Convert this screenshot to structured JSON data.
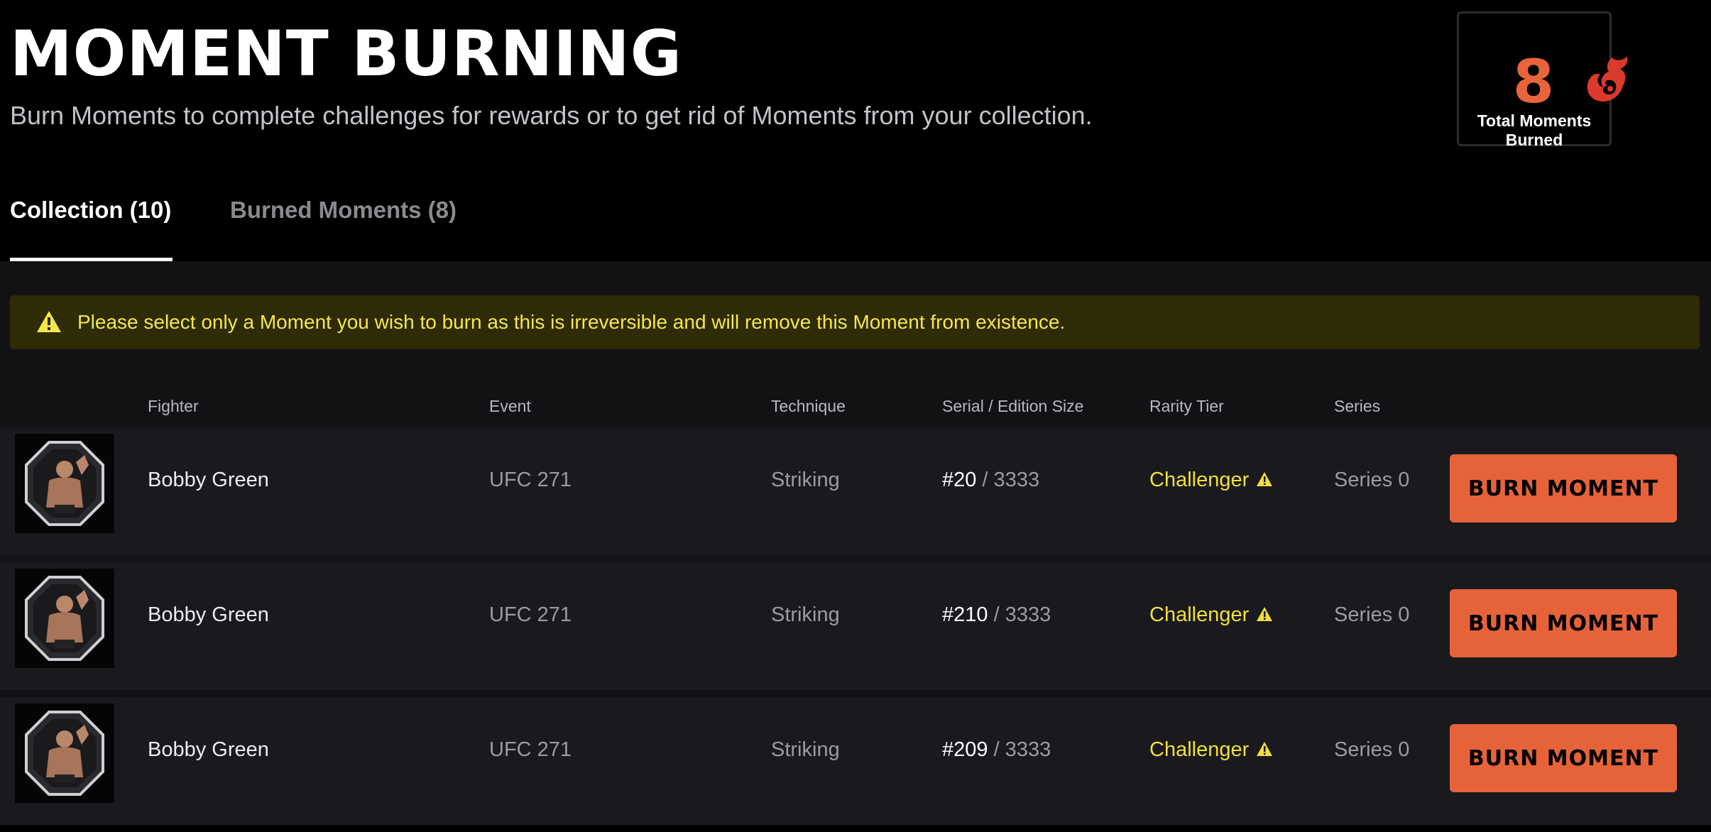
{
  "header": {
    "title": "MOMENT BURNING",
    "subtitle": "Burn Moments to complete challenges for rewards or to get rid of Moments from your collection."
  },
  "burned_card": {
    "count": "8",
    "label": "Total Moments Burned",
    "icon": "flame-icon"
  },
  "tabs": [
    {
      "label": "Collection (10)",
      "active": true
    },
    {
      "label": "Burned Moments (8)",
      "active": false
    }
  ],
  "warning": {
    "icon": "warning-icon",
    "text": "Please select only a Moment you wish to burn as this is irreversible and will remove this Moment from existence."
  },
  "table": {
    "columns": [
      "Fighter",
      "Event",
      "Technique",
      "Serial / Edition Size",
      "Rarity Tier",
      "Series"
    ],
    "rows": [
      {
        "fighter": "Bobby Green",
        "event": "UFC 271",
        "technique": "Striking",
        "serial": "#20",
        "edition": " / 3333",
        "rarity": "Challenger",
        "series": "Series 0",
        "action": "BURN MOMENT"
      },
      {
        "fighter": "Bobby Green",
        "event": "UFC 271",
        "technique": "Striking",
        "serial": "#210",
        "edition": " / 3333",
        "rarity": "Challenger",
        "series": "Series 0",
        "action": "BURN MOMENT"
      },
      {
        "fighter": "Bobby Green",
        "event": "UFC 271",
        "technique": "Striking",
        "serial": "#209",
        "edition": " / 3333",
        "rarity": "Challenger",
        "series": "Series 0",
        "action": "BURN MOMENT"
      }
    ]
  },
  "colors": {
    "accent": "#e6633a",
    "warning_bg": "#2f2b07",
    "warning_text": "#f3e84a",
    "rarity": "#f1df3c",
    "row_bg": "#1a1a1e"
  }
}
